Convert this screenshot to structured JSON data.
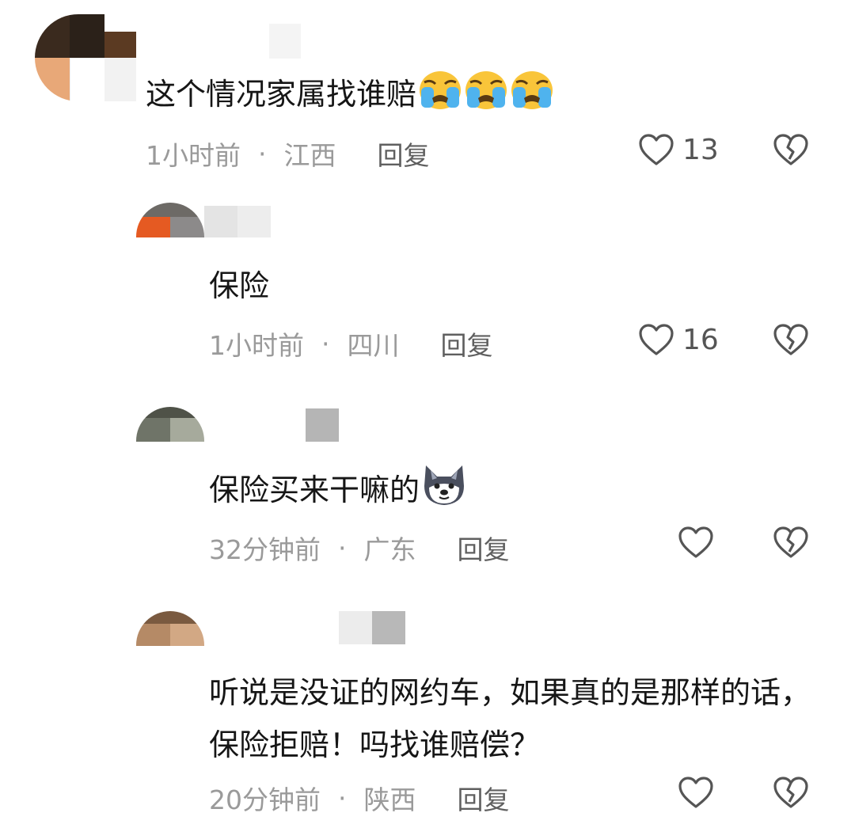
{
  "comments": [
    {
      "text": "这个情况家属找谁赔",
      "emojis": [
        "crying-face",
        "crying-face",
        "crying-face"
      ],
      "time": "1小时前",
      "location": "江西",
      "reply_label": "回复",
      "likes": "13"
    },
    {
      "text": "保险",
      "time": "1小时前",
      "location": "四川",
      "reply_label": "回复",
      "likes": "16"
    },
    {
      "text": "保险买来干嘛的",
      "emojis": [
        "dog-face"
      ],
      "time": "32分钟前",
      "location": "广东",
      "reply_label": "回复",
      "likes": ""
    },
    {
      "text": "听说是没证的网约车，如果真的是那样的话，保险拒赔！吗找谁赔偿？",
      "time": "20分钟前",
      "location": "陕西",
      "reply_label": "回复",
      "likes": ""
    }
  ],
  "separator": "·",
  "colors": {
    "text": "#161616",
    "meta": "#9a9a9a",
    "reply": "#5f5f5f",
    "icon": "#555555"
  }
}
